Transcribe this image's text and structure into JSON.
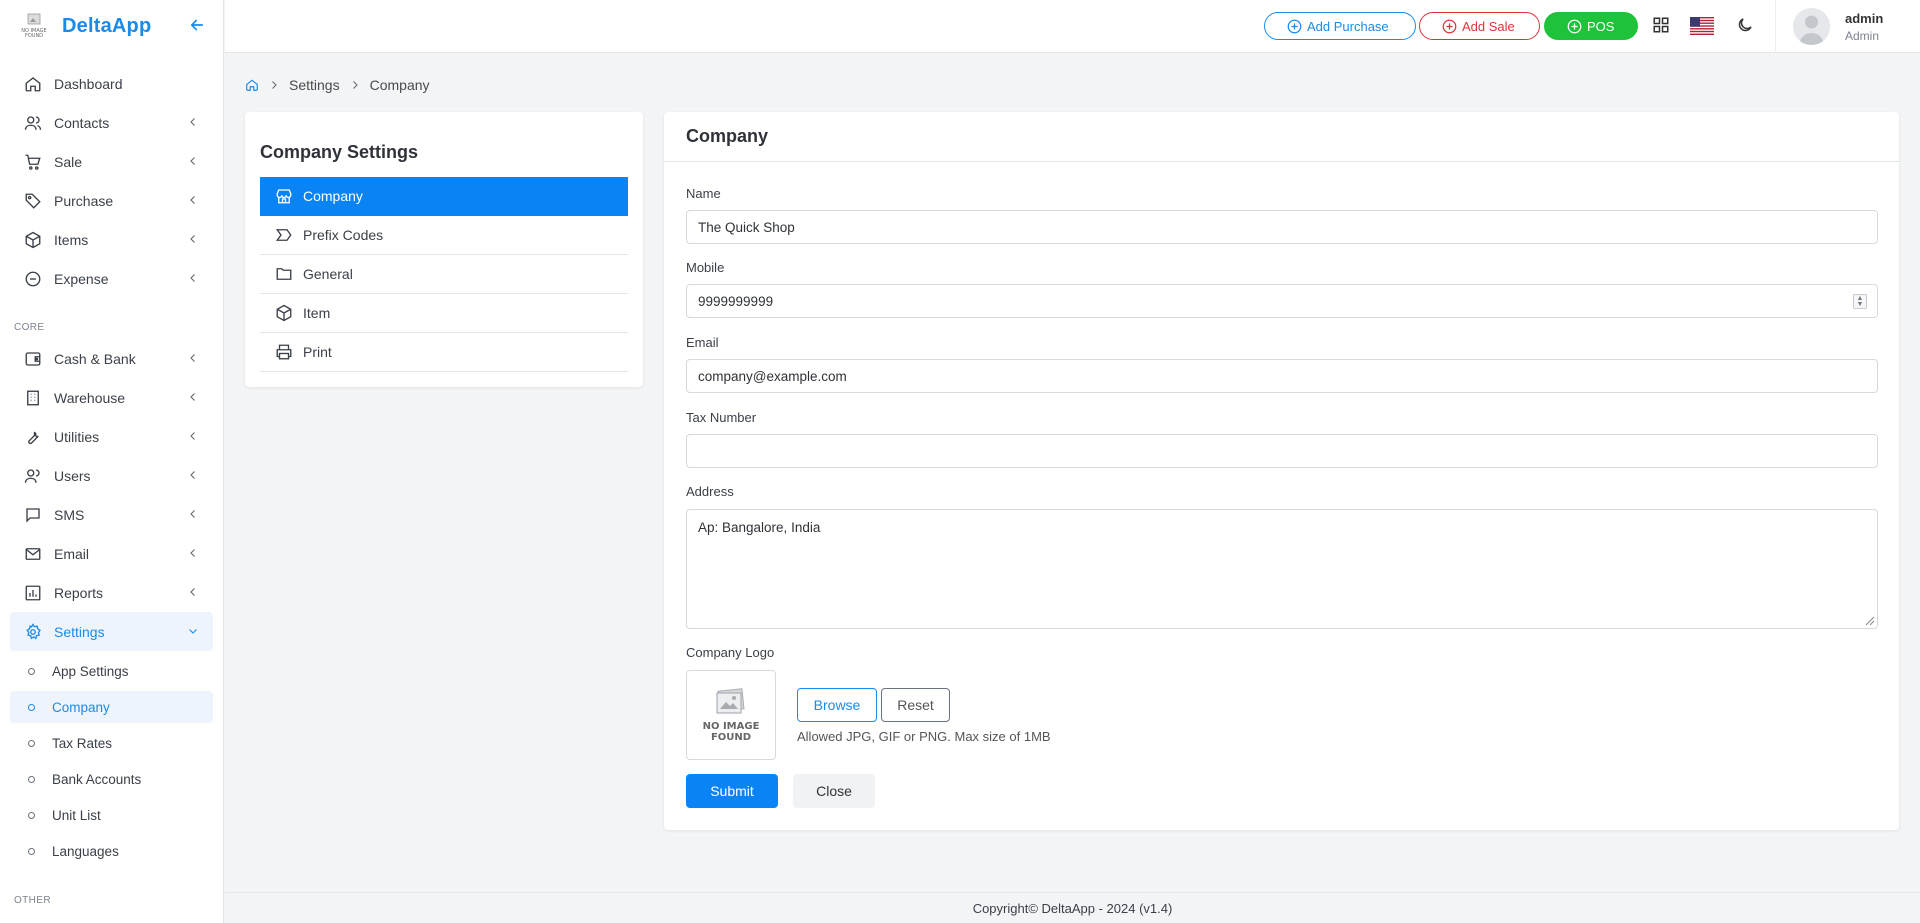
{
  "brand": {
    "logo_text": "NO IMAGE FOUND",
    "name": "DeltaApp"
  },
  "sidebar": {
    "items_top": [
      {
        "label": "Dashboard",
        "icon": "home-icon"
      },
      {
        "label": "Contacts",
        "icon": "users-icon"
      },
      {
        "label": "Sale",
        "icon": "cart-icon"
      },
      {
        "label": "Purchase",
        "icon": "tag-icon"
      },
      {
        "label": "Items",
        "icon": "box-icon"
      },
      {
        "label": "Expense",
        "icon": "minus-circle-icon"
      }
    ],
    "section_core": "CORE",
    "items_core": [
      {
        "label": "Cash & Bank",
        "icon": "wallet-icon"
      },
      {
        "label": "Warehouse",
        "icon": "building-icon"
      },
      {
        "label": "Utilities",
        "icon": "wrench-icon"
      },
      {
        "label": "Users",
        "icon": "user-icon"
      },
      {
        "label": "SMS",
        "icon": "message-icon"
      },
      {
        "label": "Email",
        "icon": "mail-icon"
      },
      {
        "label": "Reports",
        "icon": "report-icon"
      },
      {
        "label": "Settings",
        "icon": "gear-icon"
      }
    ],
    "settings_sub": [
      "App Settings",
      "Company",
      "Tax Rates",
      "Bank Accounts",
      "Unit List",
      "Languages"
    ],
    "section_other": "OTHER"
  },
  "topbar": {
    "add_purchase": "Add Purchase",
    "add_sale": "Add Sale",
    "pos": "POS",
    "user_name": "admin",
    "user_role": "Admin",
    "colors": {
      "primary": "#1a8be8",
      "danger": "#e0323a",
      "success": "#1fc23b"
    }
  },
  "breadcrumb": {
    "settings": "Settings",
    "company": "Company"
  },
  "company_settings": {
    "title": "Company Settings",
    "menu": [
      {
        "label": "Company",
        "icon": "store-icon"
      },
      {
        "label": "Prefix Codes",
        "icon": "prefix-icon"
      },
      {
        "label": "General",
        "icon": "folder-icon"
      },
      {
        "label": "Item",
        "icon": "box-icon"
      },
      {
        "label": "Print",
        "icon": "printer-icon"
      }
    ]
  },
  "form": {
    "title": "Company",
    "name_label": "Name",
    "name_value": "The Quick Shop",
    "mobile_label": "Mobile",
    "mobile_value": "9999999999",
    "email_label": "Email",
    "email_value": "company@example.com",
    "tax_label": "Tax Number",
    "tax_value": "",
    "address_label": "Address",
    "address_value": "Ap: Bangalore, India",
    "logo_label": "Company Logo",
    "logo_placeholder": "NO IMAGE FOUND",
    "browse": "Browse",
    "reset": "Reset",
    "hint": "Allowed JPG, GIF or PNG. Max size of 1MB",
    "submit": "Submit",
    "close": "Close"
  },
  "footer": {
    "text": "Copyright© DeltaApp - 2024 (v1.4)"
  }
}
